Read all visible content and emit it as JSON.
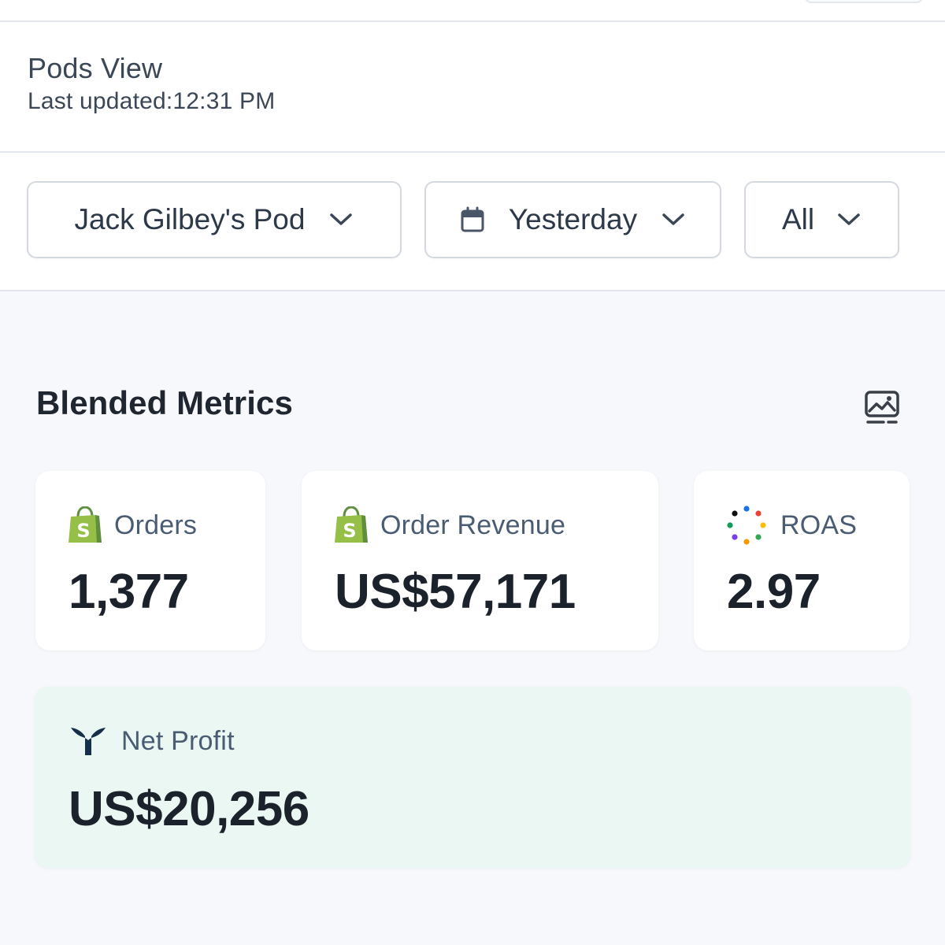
{
  "header": {
    "title": "Pods View",
    "last_updated": "Last updated:12:31 PM"
  },
  "filters": {
    "pod": {
      "label": "Jack Gilbey's Pod",
      "icon": "chevron-down-icon"
    },
    "date": {
      "label": "Yesterday",
      "icon": "calendar-icon"
    },
    "scope": {
      "label": "All",
      "icon": "chevron-down-icon"
    }
  },
  "section": {
    "title": "Blended Metrics",
    "action_icon": "image-snapshot-icon"
  },
  "metrics": [
    {
      "label": "Orders",
      "value": "1,377",
      "source_icon": "shopify-icon"
    },
    {
      "label": "Order Revenue",
      "value": "US$57,171",
      "source_icon": "shopify-icon"
    },
    {
      "label": "ROAS",
      "value": "2.97",
      "source_icon": "multi-color-dots-icon"
    }
  ],
  "net_profit": {
    "label": "Net Profit",
    "value": "US$20,256",
    "source_icon": "triple-whale-icon"
  },
  "colors": {
    "shopify_green": "#95bf47",
    "shopify_dark": "#5e8e3e",
    "profit_bg": "#ebf7f2",
    "label_text": "#4a5b74",
    "value_text": "#1c222b",
    "whale_navy": "#16304a"
  }
}
